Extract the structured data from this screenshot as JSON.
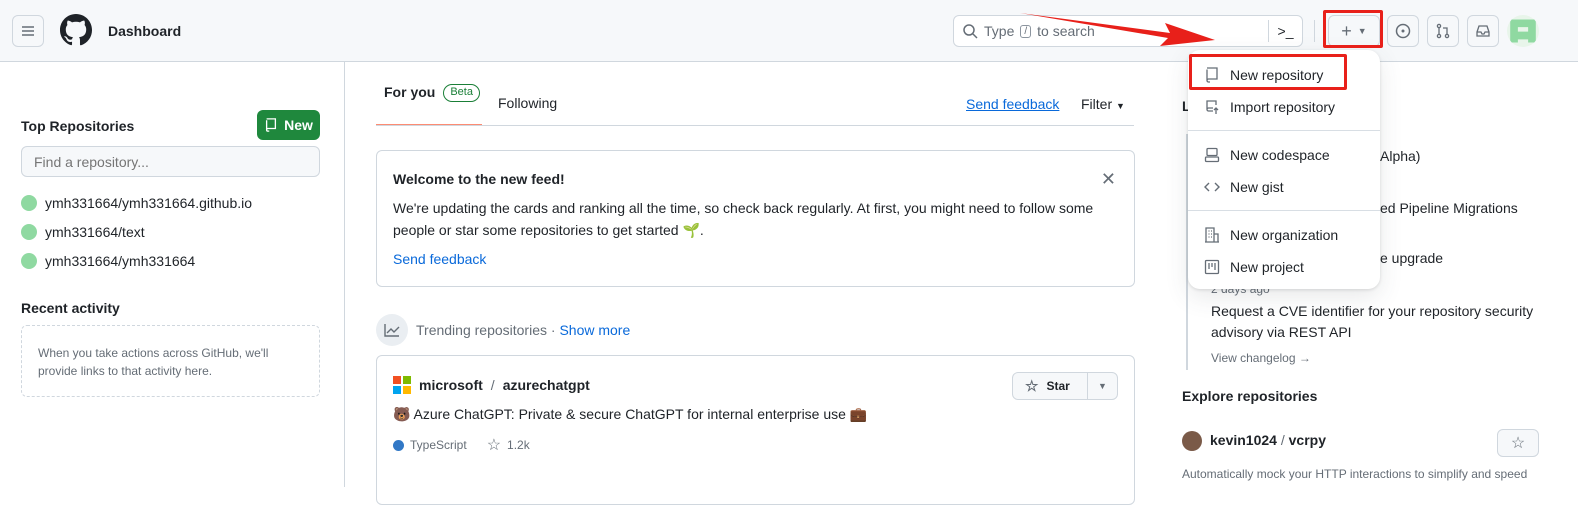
{
  "header": {
    "title": "Dashboard",
    "search_prefix": "Type",
    "search_key": "/",
    "search_suffix": "to search"
  },
  "create_menu": {
    "items": [
      {
        "label": "New repository",
        "icon": "repo-icon"
      },
      {
        "label": "Import repository",
        "icon": "repo-push-icon"
      },
      {
        "label": "New codespace",
        "icon": "codespaces-icon"
      },
      {
        "label": "New gist",
        "icon": "code-icon"
      },
      {
        "label": "New organization",
        "icon": "organization-icon"
      },
      {
        "label": "New project",
        "icon": "project-icon"
      }
    ]
  },
  "sidebar": {
    "top_repos_title": "Top Repositories",
    "new_label": "New",
    "find_placeholder": "Find a repository...",
    "repos": [
      "ymh331664/ymh331664.github.io",
      "ymh331664/text",
      "ymh331664/ymh331664"
    ],
    "recent_title": "Recent activity",
    "recent_empty": "When you take actions across GitHub, we'll provide links to that activity here."
  },
  "feed": {
    "tab_for_you": "For you",
    "beta": "Beta",
    "tab_following": "Following",
    "send_feedback": "Send feedback",
    "filter": "Filter",
    "welcome_title": "Welcome to the new feed!",
    "welcome_body": "We're updating the cards and ranking all the time, so check back regularly. At first, you might need to follow some people or star some repositories to get started 🌱.",
    "welcome_feedback": "Send feedback",
    "trending": "Trending repositories",
    "dot": "·",
    "show_more": "Show more",
    "repo_owner": "microsoft",
    "repo_sep": "/",
    "repo_name": "azurechatgpt",
    "star": "Star",
    "repo_desc": "🐻 Azure ChatGPT: Private & secure ChatGPT for internal enterprise use 💼",
    "language": "TypeScript",
    "language_color": "#3178c6",
    "stars": "1.2k"
  },
  "changes": {
    "title_visible": "L",
    "items": [
      "Alpha)",
      "ed Pipeline Migrations",
      "e upgrade"
    ],
    "time": "2 days ago",
    "last": "Request a CVE identifier for your repository security advisory via REST API",
    "view": "View changelog →"
  },
  "explore": {
    "title": "Explore repositories",
    "owner": "kevin1024",
    "sep": "/",
    "name": "vcrpy",
    "desc": "Automatically mock your HTTP interactions to simplify and speed"
  },
  "colors": {
    "accent": "#0969da",
    "primary_button": "#1f883d",
    "annotation": "#e8201a"
  }
}
